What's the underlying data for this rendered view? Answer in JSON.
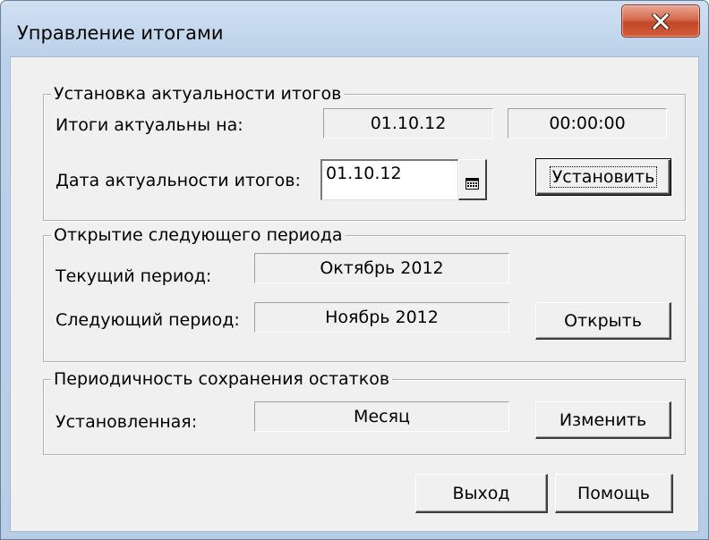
{
  "window": {
    "title": "Управление итогами",
    "close_icon": "close-x-icon"
  },
  "group_actuality": {
    "legend": "Установка актуальности итогов",
    "totals_actual_label": "Итоги актуальны на:",
    "totals_actual_date": "01.10.12",
    "totals_actual_time": "00:00:00",
    "actuality_date_label": "Дата актуальности итогов:",
    "actuality_date_value": "01.10.12",
    "calendar_icon": "calendar-icon",
    "set_button": "Установить"
  },
  "group_next_period": {
    "legend": "Открытие следующего периода",
    "current_period_label": "Текущий период:",
    "current_period_value": "Октябрь 2012",
    "next_period_label": "Следующий период:",
    "next_period_value": "Ноябрь 2012",
    "open_button": "Открыть"
  },
  "group_balance_periodicity": {
    "legend": "Периодичность сохранения остатков",
    "set_label": "Установленная:",
    "set_value": "Месяц",
    "change_button": "Изменить"
  },
  "footer": {
    "exit_button": "Выход",
    "help_button": "Помощь"
  },
  "colors": {
    "close_button": "#c14727",
    "dialog_face": "#f0f0f0",
    "window_frame": "#b7cde6"
  }
}
